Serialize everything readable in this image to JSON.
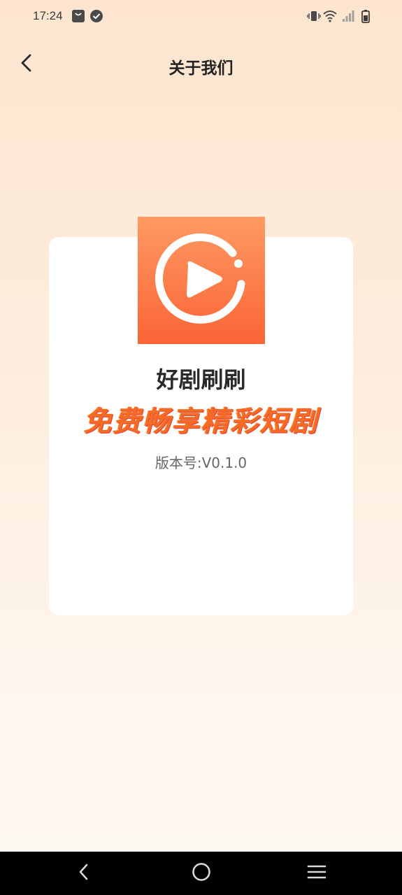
{
  "status_bar": {
    "time": "17:24",
    "left_icons": [
      "shopping-bag-icon",
      "check-circle-icon"
    ],
    "right_icons": [
      "vibrate-icon",
      "wifi-icon",
      "signal-icon",
      "battery-icon"
    ]
  },
  "header": {
    "back_icon": "chevron-left-icon",
    "title": "关于我们"
  },
  "about": {
    "logo_icon": "play-circle-icon",
    "app_name": "好剧刷刷",
    "slogan": "免费畅享精彩短剧",
    "version_label": "版本号:",
    "version_value": "V0.1.0"
  },
  "nav_bar": {
    "buttons": [
      "back-triangle-icon",
      "home-circle-icon",
      "menu-lines-icon"
    ]
  },
  "colors": {
    "background_top": "#fde5cf",
    "background_bottom": "#fffaf5",
    "logo_gradient_top": "#fe9a63",
    "logo_gradient_bottom": "#fb6436",
    "slogan": "#f46b26",
    "card": "#ffffff",
    "nav_bar": "#000000"
  }
}
